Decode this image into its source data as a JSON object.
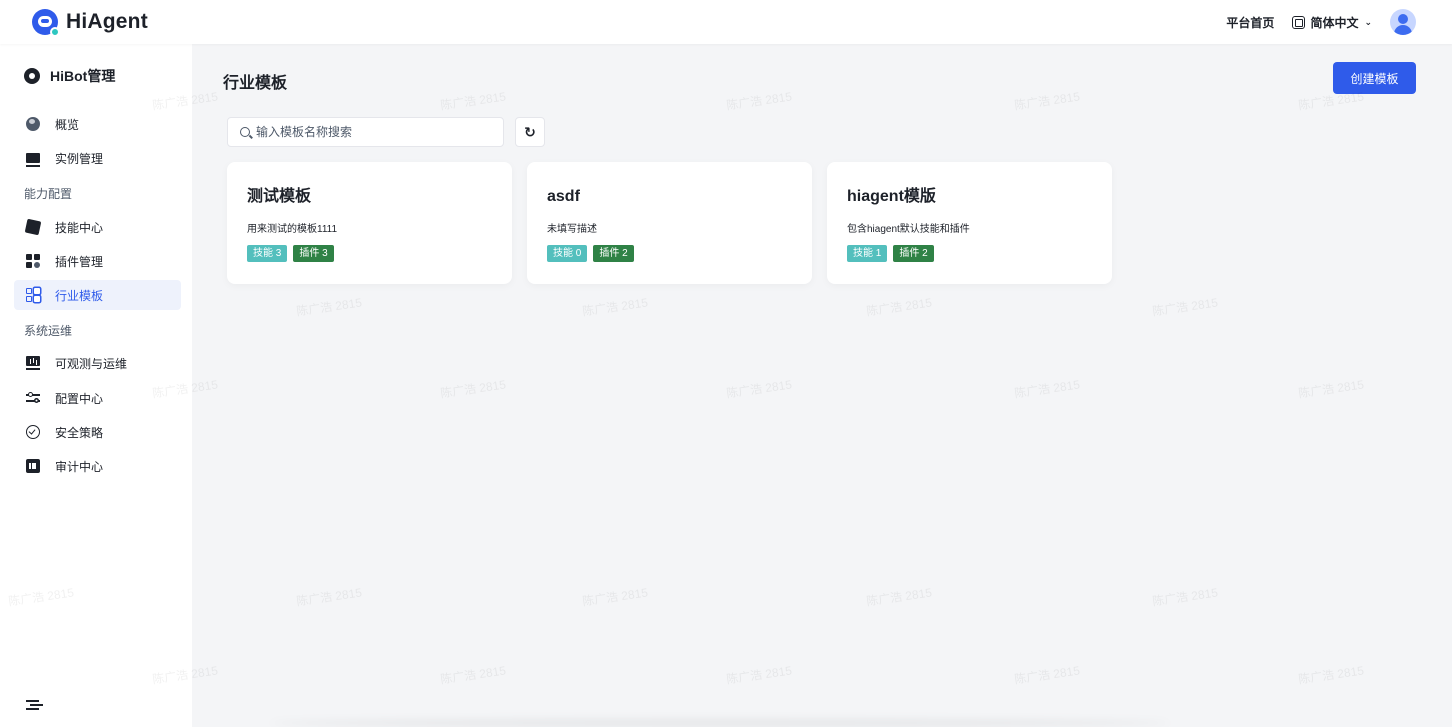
{
  "brand": {
    "name": "HiAgent"
  },
  "topbar": {
    "home_link": "平台首页",
    "language": "简体中文"
  },
  "sidebar": {
    "header": "HiBot管理",
    "items": [
      {
        "label": "概览",
        "icon": "globe-icon"
      },
      {
        "label": "实例管理",
        "icon": "monitor-icon"
      },
      {
        "label": "技能中心",
        "icon": "puzzle-icon"
      },
      {
        "label": "插件管理",
        "icon": "blocks-icon"
      },
      {
        "label": "行业模板",
        "icon": "grid-icon",
        "active": true
      },
      {
        "label": "可观测与运维",
        "icon": "chart-icon"
      },
      {
        "label": "配置中心",
        "icon": "sliders-icon"
      },
      {
        "label": "安全策略",
        "icon": "shield-check-icon"
      },
      {
        "label": "审计中心",
        "icon": "audit-icon"
      }
    ],
    "groups": [
      "能力配置",
      "系统运维"
    ]
  },
  "main": {
    "title": "行业模板",
    "create_button": "创建模板",
    "search": {
      "placeholder": "输入模板名称搜索",
      "value": ""
    },
    "cards": [
      {
        "title": "测试模板",
        "description": "用来测试的模板1111",
        "skill_tag": "技能 3",
        "plugin_tag": "插件 3"
      },
      {
        "title": "asdf",
        "description": "未填写描述",
        "skill_tag": "技能 0",
        "plugin_tag": "插件 2"
      },
      {
        "title": "hiagent模版",
        "description": "包含hiagent默认技能和插件",
        "skill_tag": "技能 1",
        "plugin_tag": "插件 2"
      }
    ]
  },
  "watermark": "陈广浩 2815",
  "colors": {
    "accent": "#2f5bea",
    "skill_tag": "#53bfbd",
    "plugin_tag": "#2f8246",
    "active_bg": "#eef2fc"
  }
}
